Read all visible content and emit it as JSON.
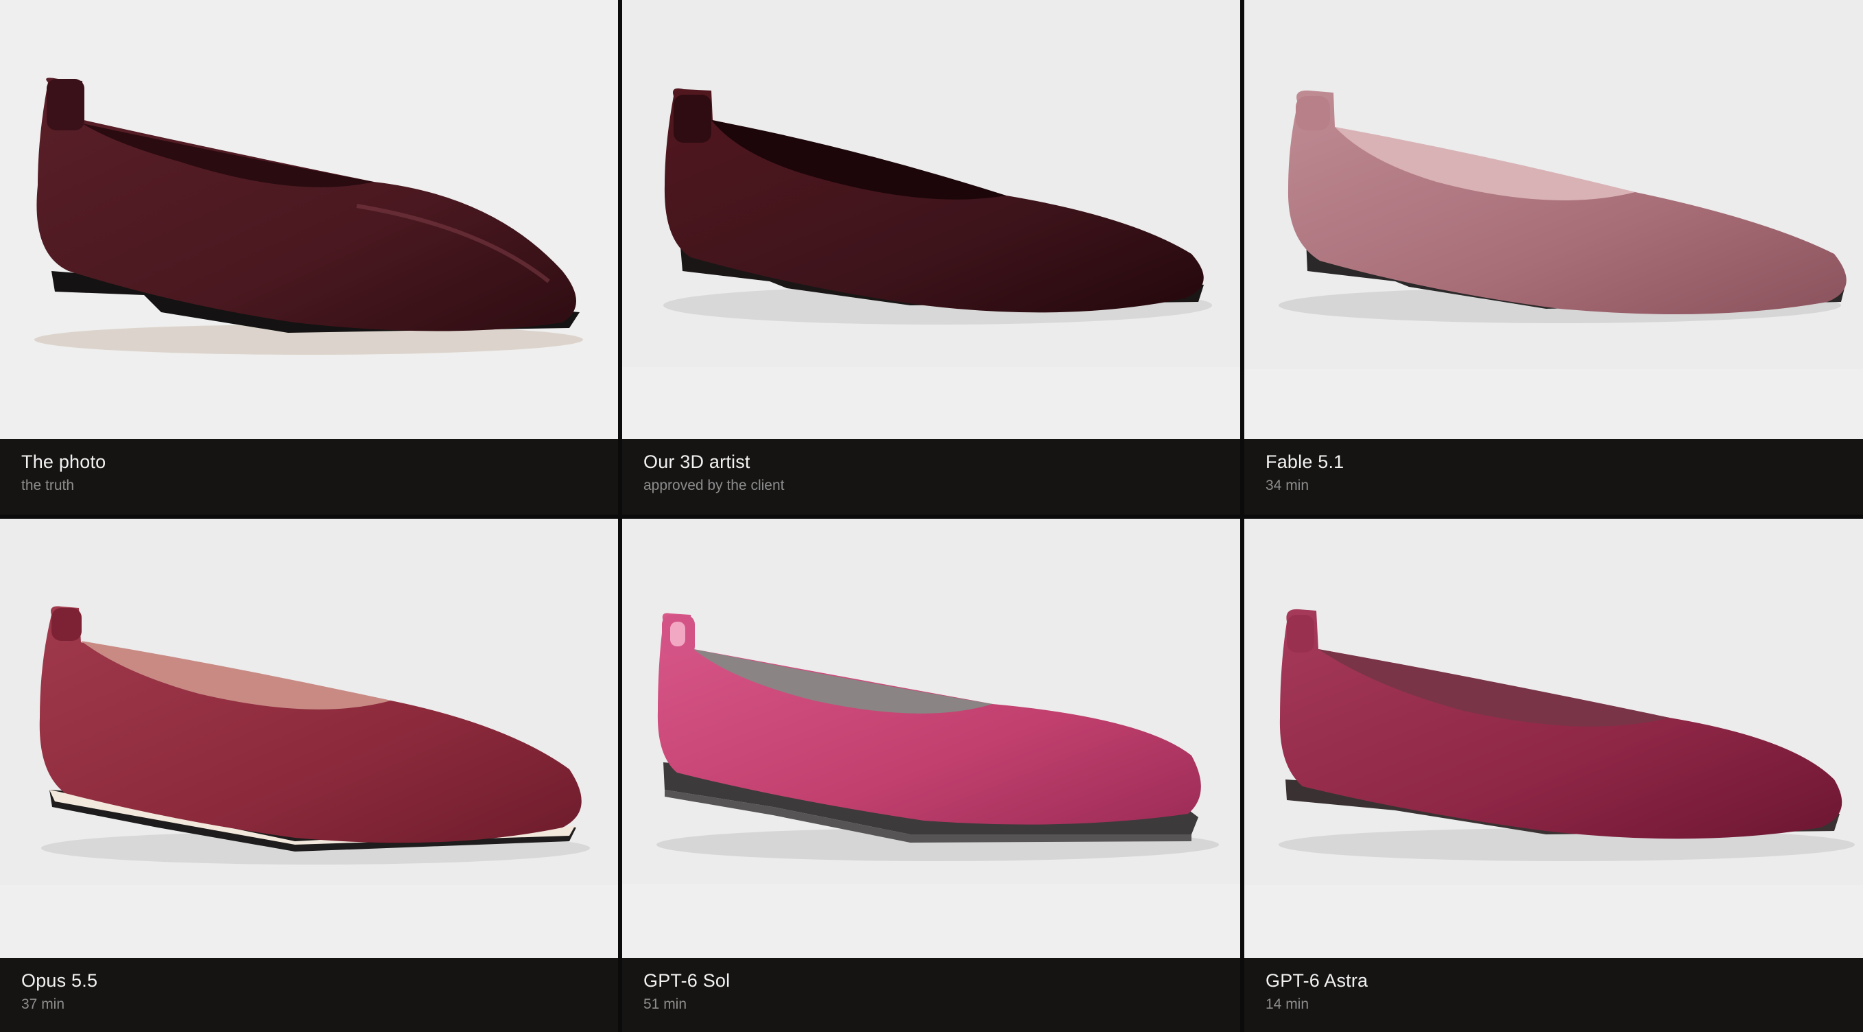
{
  "panels": [
    {
      "title": "The photo",
      "subtitle": "the truth",
      "image": "burgundy-leather-flat-shoe-photo",
      "color": "#4a1820"
    },
    {
      "title": "Our 3D artist",
      "subtitle": "approved by the client",
      "image": "burgundy-flat-shoe-3d-render",
      "color": "#3e141b"
    },
    {
      "title": "Fable 5.1",
      "subtitle": "34 min",
      "image": "dusty-rose-flat-shoe-render",
      "color": "#b07a82"
    },
    {
      "title": "Opus 5.5",
      "subtitle": "37 min",
      "image": "red-flat-shoe-render-cream-sole",
      "color": "#8c2a3c"
    },
    {
      "title": "GPT-6 Sol",
      "subtitle": "51 min",
      "image": "pink-flat-shoe-render-gray-sole",
      "color": "#c2406e"
    },
    {
      "title": "GPT-6 Astra",
      "subtitle": "14 min",
      "image": "raspberry-flat-shoe-render",
      "color": "#8e2646"
    }
  ]
}
